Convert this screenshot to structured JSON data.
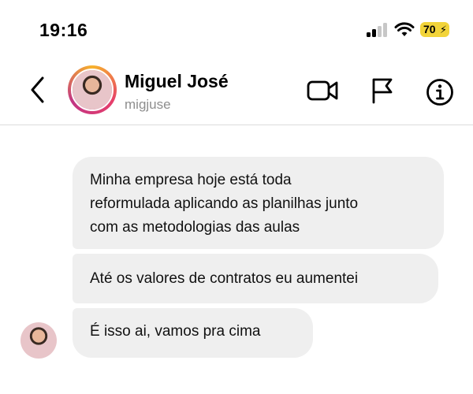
{
  "status_bar": {
    "time": "19:16",
    "battery": "70",
    "icons": [
      "cellular-signal-icon",
      "wifi-icon",
      "battery-charging-icon"
    ]
  },
  "header": {
    "name": "Miguel José",
    "username": "migjuse",
    "icons": [
      "back-chevron-icon",
      "video-call-icon",
      "flag-icon",
      "info-icon"
    ]
  },
  "messages": [
    {
      "lines": [
        "Minha empresa hoje está toda",
        "reformulada aplicando as planilhas junto",
        "com as metodologias das aulas"
      ]
    },
    {
      "lines": [
        "Até os valores de contratos eu aumentei"
      ]
    },
    {
      "lines": [
        "É isso ai, vamos pra cima"
      ]
    }
  ],
  "colors": {
    "battery": "#f2d43a",
    "bubble": "#efefef",
    "username": "#8e8e8e",
    "divider": "#dcdcdc"
  }
}
